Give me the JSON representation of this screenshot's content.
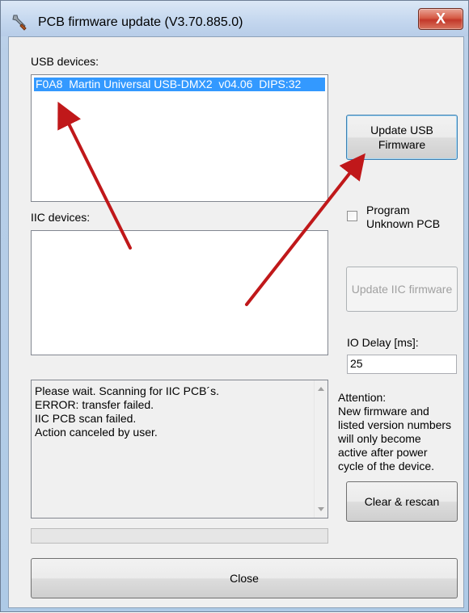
{
  "window": {
    "title": "PCB firmware update (V3.70.885.0)",
    "close_glyph": "X",
    "icon": "wrench-icon"
  },
  "usb": {
    "label": "USB devices:",
    "items": [
      "F0A8  Martin Universal USB-DMX2  v04.06  DIPS:32"
    ],
    "selected_index": 0
  },
  "iic": {
    "label": "IIC devices:",
    "items": []
  },
  "buttons": {
    "update_usb": [
      "Update USB",
      "Firmware"
    ],
    "update_iic": "Update IIC firmware",
    "clear_rescan": "Clear & rescan",
    "close": "Close"
  },
  "program_unknown": {
    "label": [
      "Program",
      "Unknown PCB"
    ],
    "checked": false
  },
  "io_delay": {
    "label": "IO Delay [ms]:",
    "value": "25"
  },
  "log": [
    "Please wait. Scanning for IIC PCB´s.",
    "ERROR: transfer failed.",
    "IIC PCB scan failed.",
    "Action canceled by user."
  ],
  "attention": [
    "Attention:",
    "New firmware and",
    "listed version numbers",
    "will only become",
    "active after power",
    "cycle of the device."
  ],
  "progress": 0,
  "colors": {
    "selection": "#3399ff",
    "annotation_arrow": "#c0181a",
    "window_frame": "#b9cfe8",
    "close_button": "#c8402f"
  }
}
